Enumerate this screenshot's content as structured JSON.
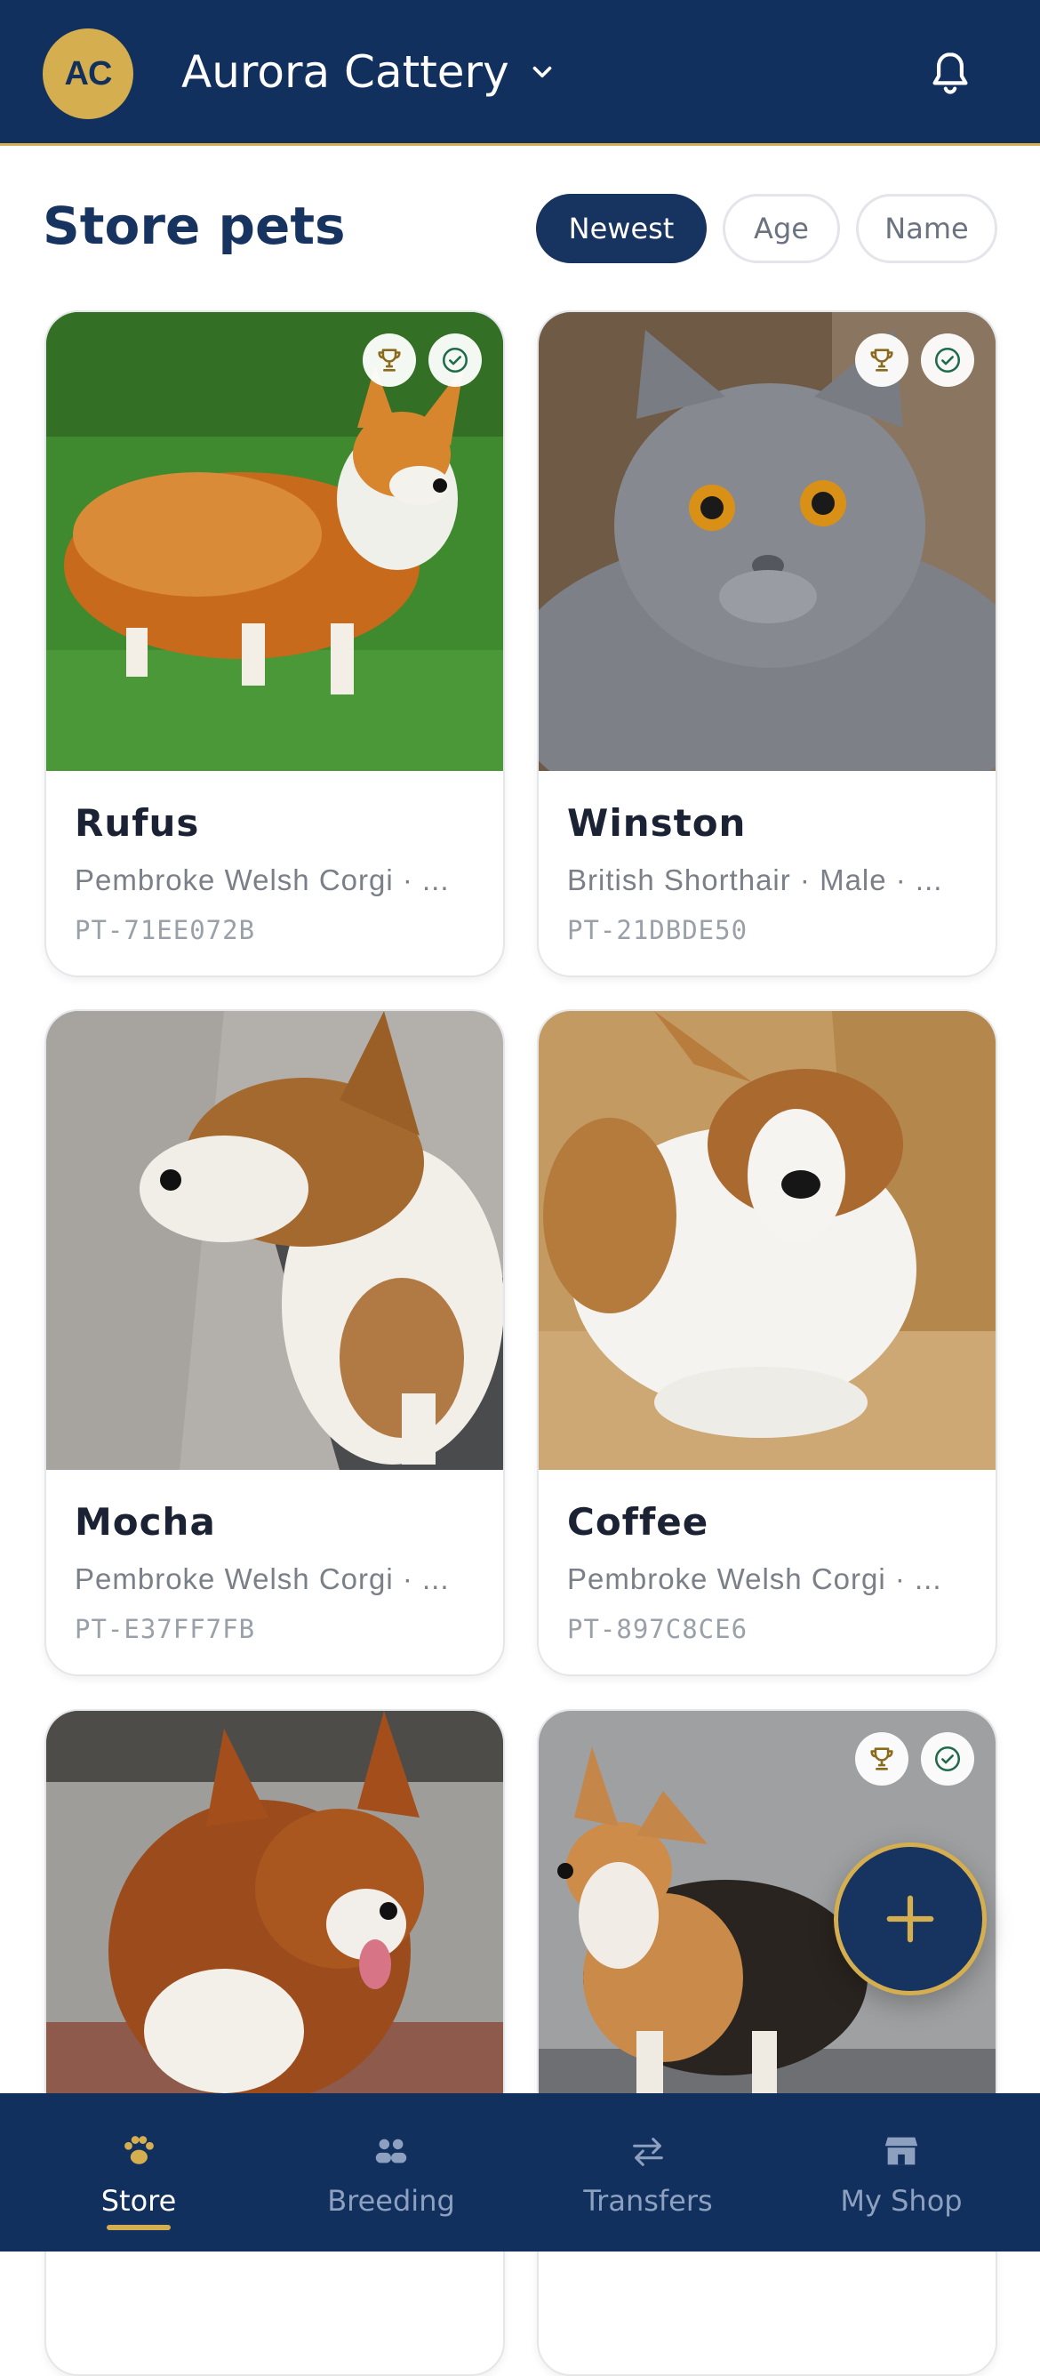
{
  "header": {
    "avatar_initials": "AC",
    "shop_name": "Aurora Cattery",
    "dropdown_icon": "chevron-down-icon",
    "notification_icon": "bell-icon"
  },
  "page": {
    "title": "Store pets",
    "sort_chips": [
      {
        "label": "Newest",
        "active": true
      },
      {
        "label": "Age",
        "active": false
      },
      {
        "label": "Name",
        "active": false
      }
    ]
  },
  "pets": [
    {
      "name": "Rufus",
      "subtitle": "Pembroke Welsh Corgi · ...",
      "id": "PT-71EE072B",
      "trophy": true,
      "verified": true
    },
    {
      "name": "Winston",
      "subtitle": "British Shorthair · Male · ...",
      "id": "PT-21DBDE50",
      "trophy": true,
      "verified": true
    },
    {
      "name": "Mocha",
      "subtitle": "Pembroke Welsh Corgi · ...",
      "id": "PT-E37FF7FB",
      "trophy": false,
      "verified": false
    },
    {
      "name": "Coffee",
      "subtitle": "Pembroke Welsh Corgi · ...",
      "id": "PT-897C8CE6",
      "trophy": false,
      "verified": false
    },
    {
      "name": "",
      "subtitle": "",
      "id": "",
      "trophy": false,
      "verified": false
    },
    {
      "name": "",
      "subtitle": "",
      "id": "",
      "trophy": true,
      "verified": true
    }
  ],
  "fab": {
    "icon": "plus-icon"
  },
  "bottom_nav": [
    {
      "label": "Store",
      "icon": "paw-icon",
      "active": true
    },
    {
      "label": "Breeding",
      "icon": "pair-icon",
      "active": false
    },
    {
      "label": "Transfers",
      "icon": "transfer-arrows-icon",
      "active": false
    },
    {
      "label": "My Shop",
      "icon": "storefront-icon",
      "active": false
    }
  ],
  "colors": {
    "navy": "#11305e",
    "gold": "#d4ae4f",
    "accent_green": "#1f6b4a"
  }
}
